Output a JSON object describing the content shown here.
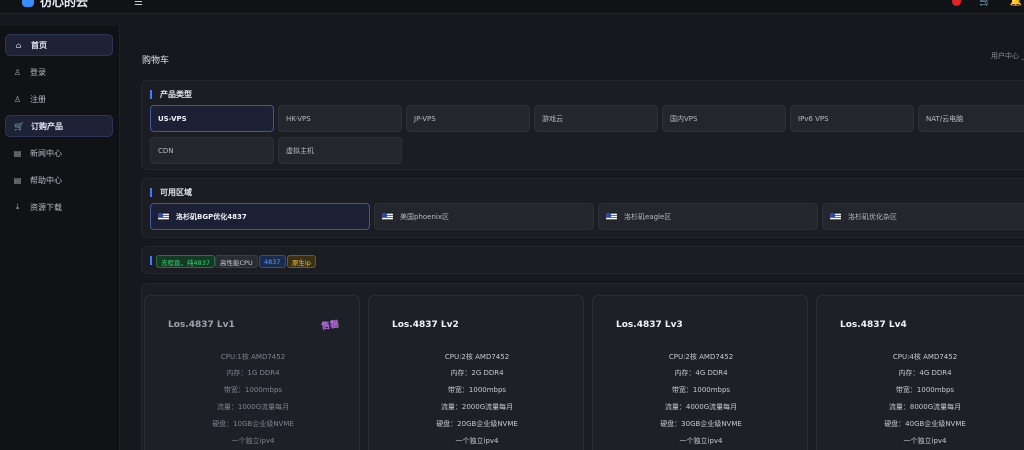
{
  "app": {
    "name": "彷心的云",
    "brand_color": "#3a8dff"
  },
  "header": {
    "menu_icon": "hamburger-icon",
    "cart_icon": "cart-icon",
    "bell_icon": "bell-icon"
  },
  "sidebar": {
    "items": [
      {
        "label": "首页",
        "icon": "home-icon",
        "active": true
      },
      {
        "label": "登录",
        "icon": "user-icon",
        "active": false
      },
      {
        "label": "注册",
        "icon": "user-icon",
        "active": false
      },
      {
        "label": "订购产品",
        "icon": "cart-icon",
        "active": true
      },
      {
        "label": "新闻中心",
        "icon": "news-icon",
        "active": false
      },
      {
        "label": "帮助中心",
        "icon": "help-icon",
        "active": false
      },
      {
        "label": "资源下载",
        "icon": "download-icon",
        "active": false
      }
    ]
  },
  "page": {
    "title": "购物车",
    "breadcrumb": "用户中心 _"
  },
  "product_types": {
    "title": "产品类型",
    "options": [
      {
        "label": "US-VPS",
        "active": true
      },
      {
        "label": "HK-VPS",
        "active": false
      },
      {
        "label": "JP-VPS",
        "active": false
      },
      {
        "label": "游戏云",
        "active": false
      },
      {
        "label": "国内VPS",
        "active": false
      },
      {
        "label": "IPv6 VPS",
        "active": false
      },
      {
        "label": "NAT/云电脑",
        "active": false
      },
      {
        "label": "CDN",
        "active": false
      },
      {
        "label": "虚拟主机",
        "active": false
      }
    ]
  },
  "zones": {
    "title": "可用区域",
    "options": [
      {
        "label": "洛杉矶BGP优化4837",
        "active": true
      },
      {
        "label": "美国phoenix区",
        "active": false
      },
      {
        "label": "洛杉矶eagle区",
        "active": false
      },
      {
        "label": "洛杉矶优化杂区",
        "active": false
      }
    ]
  },
  "tags": [
    {
      "label": "去程直，纯4837",
      "bg": "#173824",
      "fg": "#36d37a",
      "border": "#2c6e43"
    },
    {
      "label": "高性能CPU",
      "bg": "#2a2c33",
      "fg": "#c8cad2",
      "border": "#3a3d46"
    },
    {
      "label": "4837",
      "bg": "#1a2c4e",
      "fg": "#5b9cff",
      "border": "#2f4e86"
    },
    {
      "label": "原生ip",
      "bg": "#3a3014",
      "fg": "#f0c33c",
      "border": "#6d5a23"
    }
  ],
  "plans": [
    {
      "name": "Los.4837 Lv1",
      "sold_out": "售罄",
      "specs": [
        "CPU:1核 AMD7452",
        "内存：1G DDR4",
        "带宽：1000mbps",
        "流量：1000G流量每月",
        "硬盘：10GB企业级NVME",
        "一个独立ipv4"
      ]
    },
    {
      "name": "Los.4837 Lv2",
      "specs": [
        "CPU:2核 AMD7452",
        "内存：2G DDR4",
        "带宽：1000mbps",
        "流量：2000G流量每月",
        "硬盘：20GB企业级NVME",
        "一个独立ipv4"
      ]
    },
    {
      "name": "Los.4837 Lv3",
      "specs": [
        "CPU:2核 AMD7452",
        "内存：4G DDR4",
        "带宽：1000mbps",
        "流量：4000G流量每月",
        "硬盘：30GB企业级NVME",
        "一个独立ipv4"
      ]
    },
    {
      "name": "Los.4837 Lv4",
      "specs": [
        "CPU:4核 AMD7452",
        "内存：4G DDR4",
        "带宽：1000mbps",
        "流量：8000G流量每月",
        "硬盘：40GB企业级NVME",
        "一个独立ipv4"
      ]
    }
  ]
}
